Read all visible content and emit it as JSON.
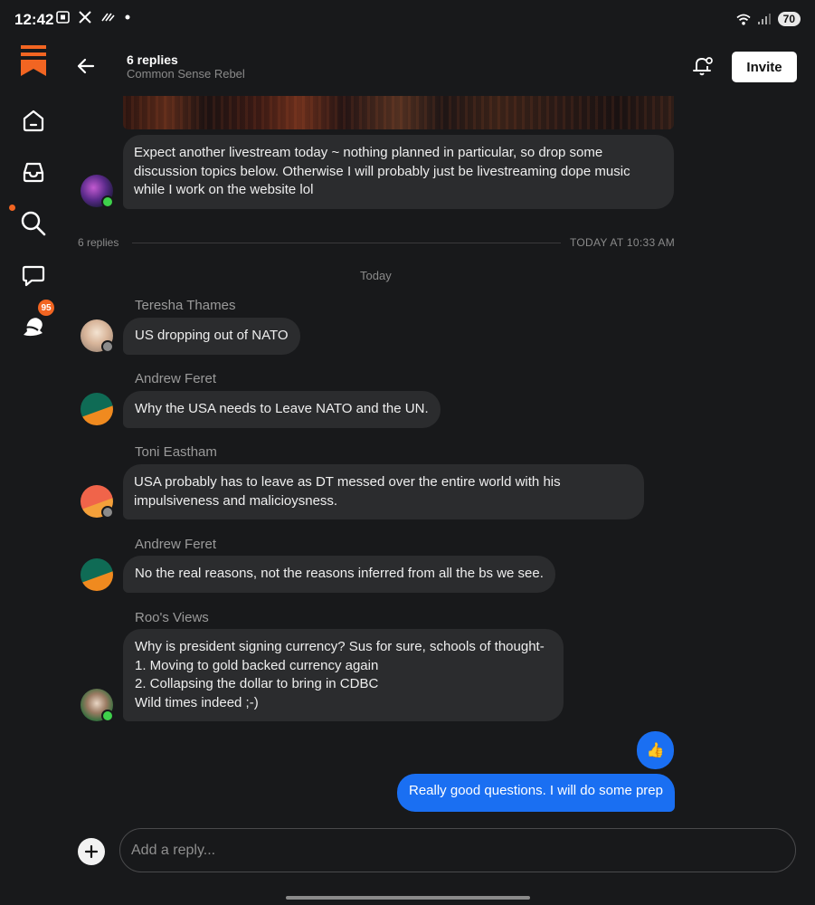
{
  "status_bar": {
    "time": "12:42",
    "left_icons": [
      "screenshot-icon",
      "x-icon",
      "wind-icon",
      "dot-icon"
    ],
    "battery": "70"
  },
  "rail": {
    "items": [
      "logo-icon",
      "home-icon",
      "inbox-icon",
      "search-icon",
      "chat-icon",
      "bell-icon"
    ],
    "chat_badge": "95",
    "accent": "#f26522"
  },
  "header": {
    "title": "6 replies",
    "subtitle": "Common Sense Rebel",
    "invite_label": "Invite"
  },
  "original_post": {
    "text": "Expect another livestream today ~ nothing planned in particular, so drop some discussion topics below. Otherwise I will probably just be livestreaming dope music while I work on the website lol"
  },
  "divider": {
    "left": "6 replies",
    "right": "TODAY AT 10:33 AM"
  },
  "day_label": "Today",
  "messages": [
    {
      "author": "Teresha  Thames",
      "text": "US dropping out of NATO"
    },
    {
      "author": "Andrew Feret",
      "text": "Why the USA needs to Leave NATO and the UN."
    },
    {
      "author": "Toni Eastham",
      "text": "USA probably has to leave as DT messed over the entire world with his impulsiveness and malicioysness."
    },
    {
      "author": "Andrew Feret",
      "text": "No the real reasons, not the reasons inferred from all the bs we see."
    },
    {
      "author": "Roo's Views",
      "lines": [
        "Why is president signing currency?  Sus for sure, schools of thought-",
        "1. Moving to gold backed currency again",
        "2. Collapsing the dollar to bring in CDBC",
        "Wild times indeed ;-)"
      ]
    }
  ],
  "my_messages": [
    {
      "text": "👍"
    },
    {
      "text": "Really good questions. I will do some prep"
    }
  ],
  "composer": {
    "placeholder": "Add a reply..."
  },
  "colors": {
    "background": "#18191b",
    "bubble": "#2b2c2e",
    "my_bubble": "#1a6ff2"
  }
}
